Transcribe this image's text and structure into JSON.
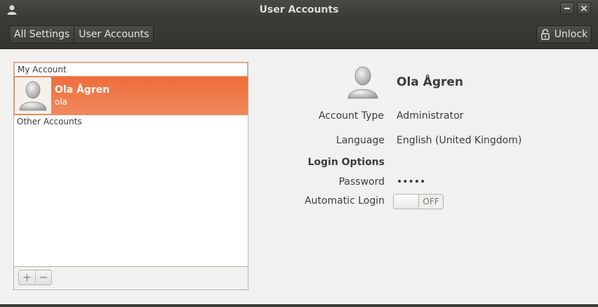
{
  "window": {
    "title": "User Accounts"
  },
  "toolbar": {
    "breadcrumbs": [
      "All Settings",
      "User Accounts"
    ],
    "unlock_label": "Unlock"
  },
  "userlist": {
    "my_account_header": "My Account",
    "selected_user": {
      "name": "Ola Ågren",
      "login": "ola"
    },
    "other_accounts_header": "Other Accounts",
    "add_label": "+",
    "remove_label": "−"
  },
  "details": {
    "name": "Ola Ågren",
    "account_type_label": "Account Type",
    "account_type_value": "Administrator",
    "language_label": "Language",
    "language_value": "English (United Kingdom)",
    "login_options_label": "Login Options",
    "password_label": "Password",
    "password_value": "•••••",
    "autologin_label": "Automatic Login",
    "autologin_state": "OFF"
  },
  "colors": {
    "accent": "#ef6c3a",
    "chrome": "#3c3b37",
    "background": "#f2f1f0"
  }
}
